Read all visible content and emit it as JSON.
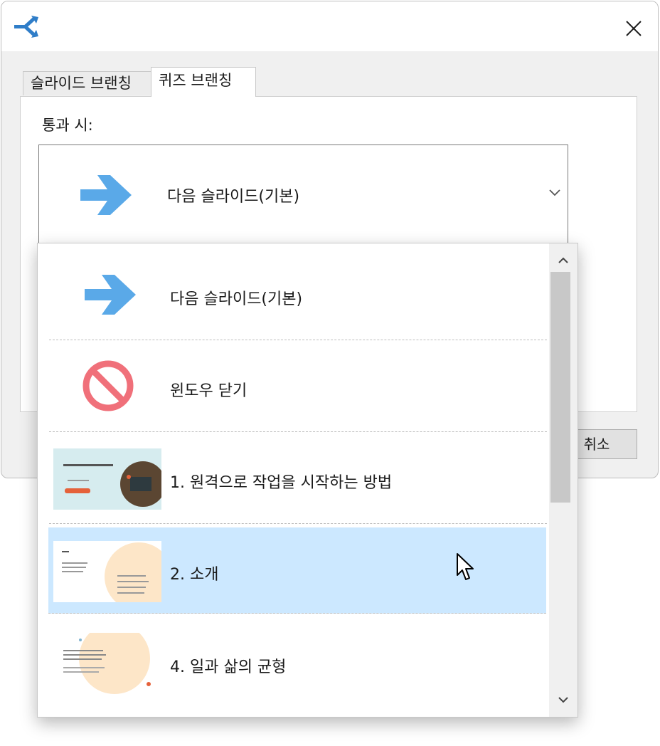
{
  "tabs": [
    {
      "label": "슬라이드 브랜칭",
      "active": false
    },
    {
      "label": "퀴즈 브랜칭",
      "active": true
    }
  ],
  "panel": {
    "label": "통과 시:"
  },
  "combo": {
    "selected": "다음 슬라이드(기본)"
  },
  "buttons": {
    "cancel_label": "취소"
  },
  "dropdown": {
    "items": [
      {
        "label": "다음 슬라이드(기본)",
        "icon": "arrow-right-icon"
      },
      {
        "label": "윈도우 닫기",
        "icon": "no-entry-icon"
      },
      {
        "label": "1. 원격으로 작업을 시작하는 방법",
        "icon": "slide-thumbnail"
      },
      {
        "label": "2. 소개",
        "icon": "slide-thumbnail",
        "hovered": true
      },
      {
        "label": "4. 일과 삶의 균형",
        "icon": "slide-thumbnail"
      }
    ]
  },
  "colors": {
    "accent_arrow": "#5aa9e8",
    "no_entry_red": "#f0707a",
    "hover_bg": "#cce8ff",
    "dialog_bg": "#f0f0f0"
  }
}
